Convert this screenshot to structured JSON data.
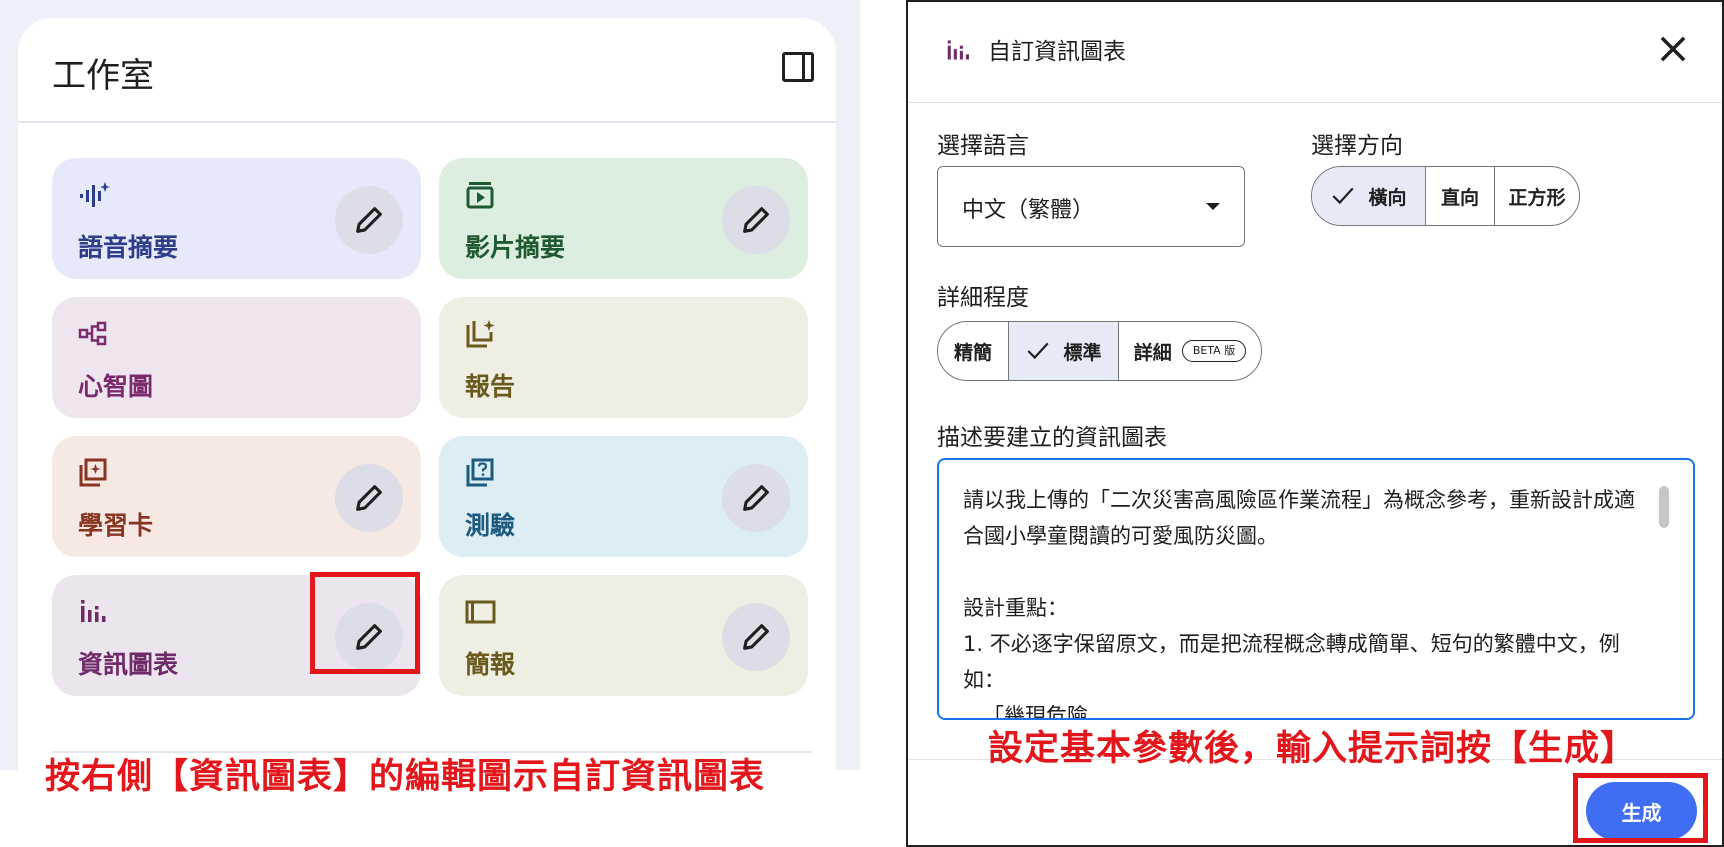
{
  "studio": {
    "title": "工作室",
    "cards": [
      {
        "label": "語音摘要",
        "icon": "audio-waveform-icon",
        "has_edit": true
      },
      {
        "label": "影片摘要",
        "icon": "video-icon",
        "has_edit": true
      },
      {
        "label": "心智圖",
        "icon": "mind-map-icon",
        "has_edit": false
      },
      {
        "label": "報告",
        "icon": "report-icon",
        "has_edit": false
      },
      {
        "label": "學習卡",
        "icon": "flashcard-icon",
        "has_edit": true
      },
      {
        "label": "測驗",
        "icon": "quiz-icon",
        "has_edit": true
      },
      {
        "label": "資訊圖表",
        "icon": "infographic-icon",
        "has_edit": true
      },
      {
        "label": "簡報",
        "icon": "slides-icon",
        "has_edit": true
      }
    ]
  },
  "annotations": {
    "left_caption": "按右側【資訊圖表】的編輯圖示自訂資訊圖表",
    "right_caption": "設定基本參數後，輸入提示詞按【生成】",
    "highlight_color": "#e3171b"
  },
  "dialog": {
    "title": "自訂資訊圖表",
    "language_label": "選擇語言",
    "language_value": "中文（繁體）",
    "orientation_label": "選擇方向",
    "orientation_options": [
      "橫向",
      "直向",
      "正方形"
    ],
    "orientation_selected": "橫向",
    "detail_label": "詳細程度",
    "detail_options": [
      "精簡",
      "標準",
      "詳細"
    ],
    "detail_selected": "標準",
    "beta_badge": "BETA 版",
    "describe_label": "描述要建立的資訊圖表",
    "prompt_text": "請以我上傳的「二次災害高風險區作業流程」為概念參考，重新設計成適合國小學童閱讀的可愛風防災圖。\n\n設計重點：\n1. 不必逐字保留原文，而是把流程概念轉成簡單、短句的繁體中文，例如：\n   「幾現危險",
    "generate_label": "生成",
    "accent_color": "#3f6ef5"
  }
}
